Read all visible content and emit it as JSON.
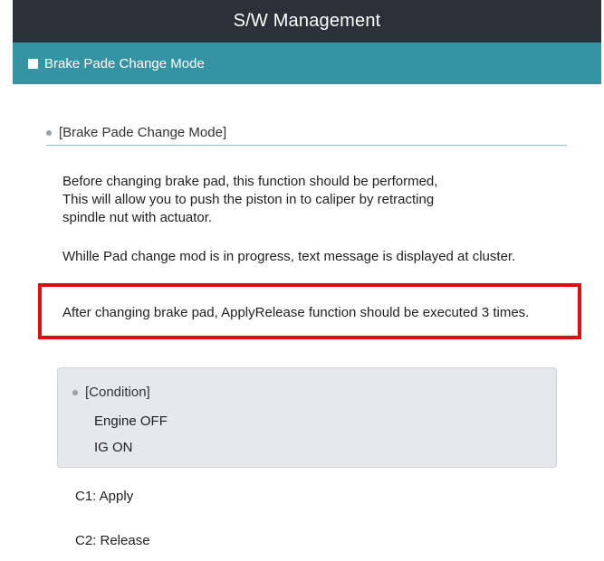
{
  "window": {
    "title": "S/W Management"
  },
  "section": {
    "title": "Brake Pade Change Mode",
    "bar_color": "#3593a3"
  },
  "subheader": {
    "label": "[Brake Pade Change Mode]"
  },
  "description": {
    "lines": [
      "Before changing brake pad, this function should be performed,",
      "This will allow you to push the piston in to caliper by retracting",
      "spindle nut with actuator."
    ],
    "progress_note": "Whille Pad change mod is in progress, text message is displayed at cluster.",
    "highlight_note": "After changing brake pad, ApplyRelease function should be executed 3 times.",
    "highlight_color": "#e20d13"
  },
  "condition": {
    "title": "[Condition]",
    "items": [
      "Engine OFF",
      "IG ON"
    ]
  },
  "commands": [
    "C1: Apply",
    "C2: Release"
  ]
}
